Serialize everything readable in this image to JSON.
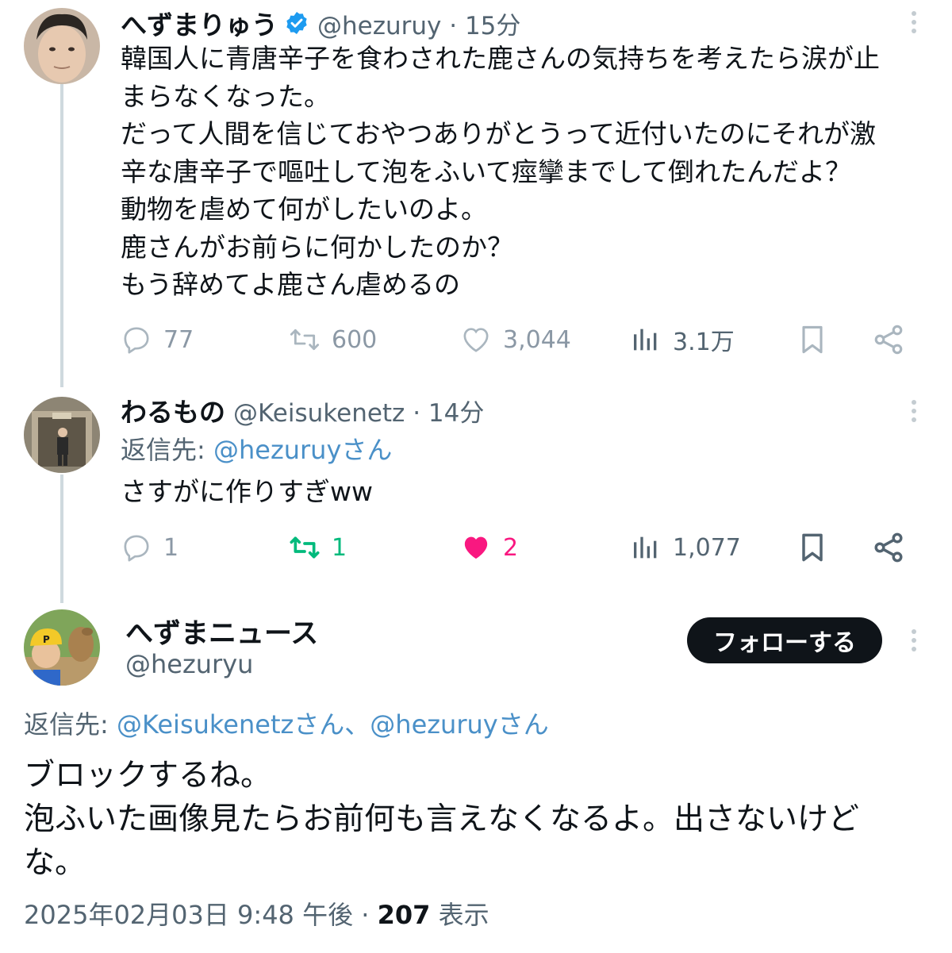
{
  "colors": {
    "text": "#0f1419",
    "secondary": "#536471",
    "mention": "#4a90c8",
    "retweet_active": "#00ba7c",
    "like_active": "#f91880",
    "verified": "#1d9bf0",
    "follow_bg": "#0f1419"
  },
  "tweet1": {
    "name": "へずまりゅう",
    "handle_meta": "@hezuruy · 15分",
    "verified_icon": "verified-badge-icon",
    "text_lines": [
      "韓国人に青唐辛子を食わされた鹿さんの気持ちを考えたら涙が止",
      "まらなくなった。",
      "だって人間を信じておやつありがとうって近付いたのにそれが激",
      "辛な唐辛子で嘔吐して泡をふいて痙攣までして倒れたんだよ？",
      "動物を虐めて何がしたいのよ。",
      "鹿さんがお前らに何かしたのか？",
      "もう辞めてよ鹿さん虐めるの"
    ],
    "replies": "77",
    "retweets": "600",
    "likes": "3,044",
    "views": "3.1万"
  },
  "tweet2": {
    "name": "わるもの",
    "handle_meta": "@Keisukenetz · 14分",
    "reply_prefix": "返信先: ",
    "reply_mention": "@hezuruyさん",
    "text": "さすがに作りすぎww",
    "replies": "1",
    "retweets": "1",
    "likes": "2",
    "views": "1,077"
  },
  "tweet3": {
    "name": "へずまニュース",
    "handle": "@hezuryu",
    "follow_label": "フォローする",
    "reply_prefix": "返信先: ",
    "reply_mentions": "@Keisukenetzさん、@hezuruyさん",
    "text_lines": [
      "ブロックするね。",
      "泡ふいた画像見たらお前何も言えなくなるよ。出さないけど",
      "な。"
    ],
    "timestamp": "2025年02月03日 9:48 午後 · ",
    "view_count": "207",
    "view_label": " 表示"
  }
}
